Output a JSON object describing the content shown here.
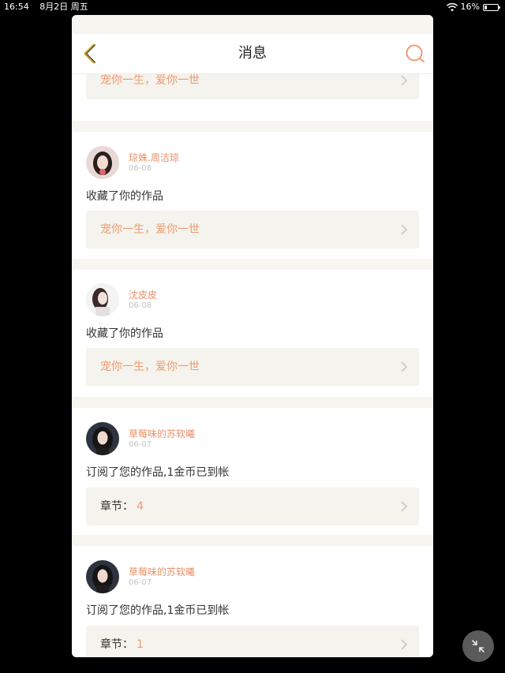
{
  "status_bar": {
    "time": "16:54",
    "date": "8月2日 周五",
    "battery": "16%",
    "battery_level": 0.16
  },
  "nav": {
    "title": "消息",
    "back_icon": "chevron-left-icon",
    "search_icon": "search-icon"
  },
  "colors": {
    "accent": "#e9906a",
    "back_icon": "#c7a422"
  },
  "messages": [
    {
      "work_title": "宠你一生，爱你一世"
    },
    {
      "username": "琼姝.周洁琼",
      "date": "06-08",
      "action": "收藏了你的作品",
      "work_title": "宠你一生，爱你一世"
    },
    {
      "username": "沈皮皮",
      "date": "06-08",
      "action": "收藏了你的作品",
      "work_title": "宠你一生，爱你一世"
    },
    {
      "username": "草莓味的苏软曦",
      "date": "06-07",
      "action": "订阅了您的作品,1金币已到帐",
      "chapter_label": "章节：",
      "chapter_num": "4"
    },
    {
      "username": "草莓味的苏软曦",
      "date": "06-07",
      "action": "订阅了您的作品,1金币已到帐",
      "chapter_label": "章节：",
      "chapter_num": "1"
    }
  ]
}
